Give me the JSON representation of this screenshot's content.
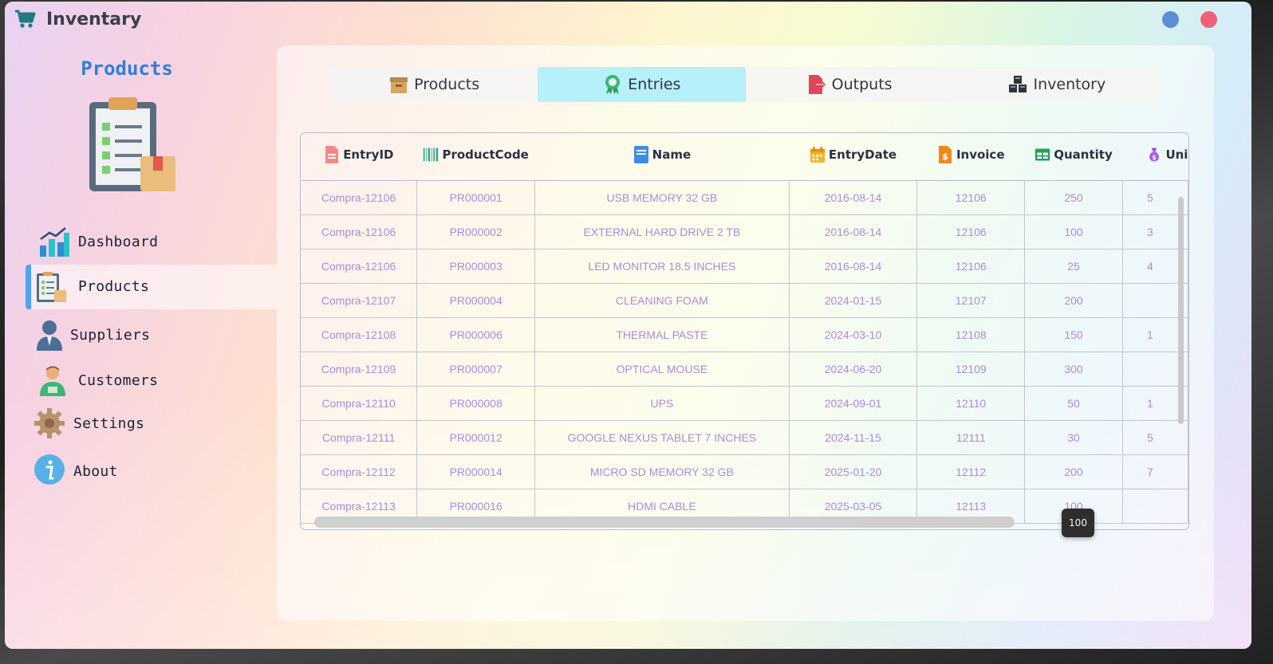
{
  "app": {
    "title": "Inventary"
  },
  "sidebar": {
    "title": "Products",
    "items": [
      {
        "label": "Dashboard",
        "icon": "bar-chart-icon",
        "active": false
      },
      {
        "label": "Products",
        "icon": "clipboard-icon",
        "active": true
      },
      {
        "label": "Suppliers",
        "icon": "user-tie-icon",
        "active": false
      },
      {
        "label": "Customers",
        "icon": "customer-icon",
        "active": false
      },
      {
        "label": "Settings",
        "icon": "gear-icon",
        "active": false
      },
      {
        "label": "About",
        "icon": "info-icon",
        "active": false
      }
    ]
  },
  "tabs": [
    {
      "label": "Products",
      "icon": "box-icon",
      "active": false
    },
    {
      "label": "Entries",
      "icon": "badge-icon",
      "active": true
    },
    {
      "label": "Outputs",
      "icon": "file-export-icon",
      "active": false
    },
    {
      "label": "Inventory",
      "icon": "cubes-icon",
      "active": false
    }
  ],
  "table": {
    "columns": [
      "EntryID",
      "ProductCode",
      "Name",
      "EntryDate",
      "Invoice",
      "Quantity",
      "Uni"
    ],
    "rows": [
      [
        "Compra-12106",
        "PR000001",
        "USB MEMORY 32 GB",
        "2016-08-14",
        "12106",
        "250",
        "5"
      ],
      [
        "Compra-12106",
        "PR000002",
        "EXTERNAL HARD DRIVE 2 TB",
        "2016-08-14",
        "12106",
        "100",
        "3"
      ],
      [
        "Compra-12106",
        "PR000003",
        "LED MONITOR 18.5 INCHES",
        "2016-08-14",
        "12106",
        "25",
        "4"
      ],
      [
        "Compra-12107",
        "PR000004",
        "CLEANING FOAM",
        "2024-01-15",
        "12107",
        "200",
        ""
      ],
      [
        "Compra-12108",
        "PR000006",
        "THERMAL PASTE",
        "2024-03-10",
        "12108",
        "150",
        "1"
      ],
      [
        "Compra-12109",
        "PR000007",
        "OPTICAL MOUSE",
        "2024-06-20",
        "12109",
        "300",
        ""
      ],
      [
        "Compra-12110",
        "PR000008",
        "UPS",
        "2024-09-01",
        "12110",
        "50",
        "1"
      ],
      [
        "Compra-12111",
        "PR000012",
        "GOOGLE NEXUS TABLET 7 INCHES",
        "2024-11-15",
        "12111",
        "30",
        "5"
      ],
      [
        "Compra-12112",
        "PR000014",
        "MICRO SD MEMORY 32 GB",
        "2025-01-20",
        "12112",
        "200",
        "7"
      ],
      [
        "Compra-12113",
        "PR000016",
        "HDMI CABLE",
        "2025-03-05",
        "12113",
        "100",
        ""
      ]
    ]
  },
  "tooltip": {
    "text": "100"
  },
  "colors": {
    "accent": "#4fa3f5",
    "active_tab": "#b6f0fb",
    "cell_text": "#a98cd6",
    "close": "#f0607a",
    "minimize": "#5b8ed6"
  }
}
